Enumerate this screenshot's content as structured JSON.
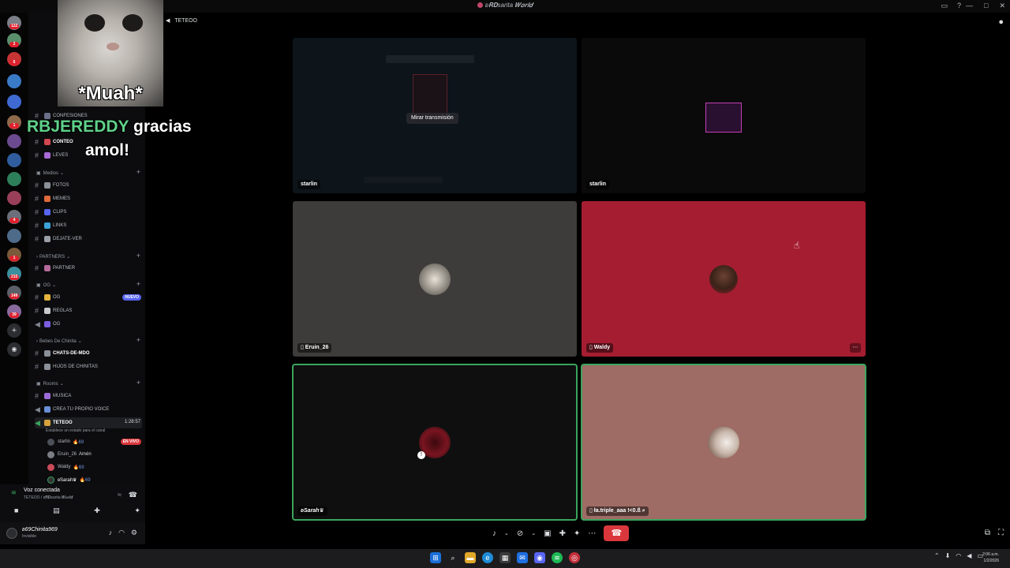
{
  "window": {
    "title": "ʚ𝐑𝐃sarita 𝑾𝒐𝒓𝒍𝒅",
    "controls": [
      "—",
      "□",
      "✕"
    ],
    "icons": [
      "inbox-icon",
      "help-icon"
    ]
  },
  "rail": {
    "badges": [
      "122",
      "2",
      "6",
      "1",
      "4",
      "1",
      "215",
      "149",
      "39"
    ]
  },
  "overlay": {
    "caption": "*Muah*",
    "donor_name": "RBJEREDDY",
    "message_part1": "gracias",
    "message_part2": "amol!"
  },
  "channels": {
    "items": [
      {
        "label": "CONFESIONES",
        "emoji_color": "#6b6f8a"
      },
      {
        "label": "CONTEO",
        "emoji_color": "#d2464f",
        "active": true
      },
      {
        "label": "LEVES",
        "emoji_color": "#a86ad6"
      }
    ],
    "medios": {
      "label": "Medios",
      "items": [
        {
          "label": "FOTOS",
          "emoji_color": "#8a8f98"
        },
        {
          "label": "MEMES",
          "emoji_color": "#e06a3c"
        },
        {
          "label": "CLIPS",
          "emoji_color": "#5865f2"
        },
        {
          "label": "LINKS",
          "emoji_color": "#3ba1d6"
        },
        {
          "label": "DEJATE-VER",
          "emoji_color": "#9a9ea6"
        }
      ]
    },
    "partners": {
      "label": "PARTNERS",
      "items": [
        {
          "label": "PARTNER",
          "emoji_color": "#b56a9b"
        }
      ]
    },
    "og": {
      "label": "OG",
      "items": [
        {
          "label": "OG",
          "emoji_color": "#e6b33c",
          "pill": "NUEVO"
        },
        {
          "label": "REGLAS",
          "emoji_color": "#c7c9cd"
        },
        {
          "label": "OG",
          "emoji_color": "#7b5ee0"
        }
      ]
    },
    "bebes": {
      "label": "Bebes De Chinita",
      "items": [
        {
          "label": "CHATS-DE-MDO",
          "emoji_color": "#8a8f98",
          "bold": true
        },
        {
          "label": "HIJOS DE CHINITAS",
          "emoji_color": "#8a8f98"
        }
      ]
    },
    "rooms": {
      "label": "Rooms",
      "items": [
        {
          "label": "MUSICA",
          "emoji_color": "#9b6ad6"
        },
        {
          "label": "CREA TU PROPIO VOICE",
          "emoji_color": "#6a8fd6"
        },
        {
          "label": "TETEOO",
          "emoji_color": "#d6a23c",
          "active": true,
          "timer": "1:28:57"
        }
      ]
    },
    "voice_status_hint": "Establece un estado para el canal",
    "live_pill": "EN VIVO",
    "voice_users": [
      {
        "name": "starlin",
        "extra": "🔥69",
        "color": "#4b4f58"
      },
      {
        "name": "Eruin_26",
        "extra": "Amén",
        "color": "#7a7d84"
      },
      {
        "name": "Waldy",
        "extra": "🔥69",
        "color": "#c84b5a"
      },
      {
        "name": "ʚSarah♛",
        "extra": "🔥69",
        "color": "#333"
      }
    ]
  },
  "voice_panel": {
    "status": "Voz conectada",
    "sub": "TETEOO / ʚ𝐑𝐃sarita 𝑾𝒐𝒓𝒍𝒅",
    "buttons": [
      "camera-icon",
      "screen-share-icon",
      "activity-icon",
      "soundboard-icon"
    ]
  },
  "user_panel": {
    "name": "ʚ69Chinita969",
    "status": "Invisible"
  },
  "main": {
    "channel_title": "TETEOO",
    "watch_stream": "Mirar transmisión",
    "tiles": [
      {
        "name": "starlin",
        "kind": "stream"
      },
      {
        "name": "starlin",
        "kind": "avatar"
      },
      {
        "name": "Eruin_26",
        "kind": "avatar"
      },
      {
        "name": "Waldy",
        "kind": "avatar"
      },
      {
        "name": "ʚSarah♛",
        "kind": "avatar"
      },
      {
        "name": "ła.triple_aaa !<0.ß",
        "kind": "avatar"
      }
    ],
    "colors": {
      "tile_gray": "#3e3c3a",
      "tile_red": "#a51d31",
      "tile_black": "#0f0f0f",
      "tile_rose": "#9e6c64",
      "speaking": "#3ba55d",
      "hangup": "#da373c"
    }
  },
  "taskbar": {
    "time": "2:06 a.m.",
    "date": "1/2/2026"
  }
}
